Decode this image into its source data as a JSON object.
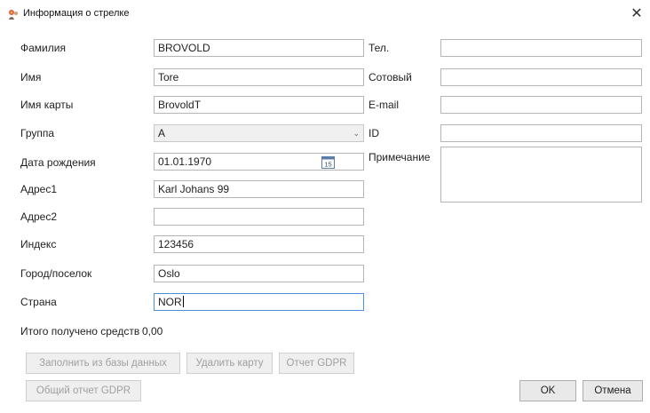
{
  "window": {
    "title": "Информация о стрелке",
    "close_glyph": "✕",
    "icon": "archer-icon"
  },
  "left_fields": [
    {
      "label": "Фамилия",
      "value": "BROVOLD"
    },
    {
      "label": "Имя",
      "value": "Tore"
    },
    {
      "label": "Имя карты",
      "value": "BrovoldT"
    },
    {
      "label": "Группа",
      "value": "A"
    },
    {
      "label": "Дата рождения",
      "value": "01.01.1970"
    },
    {
      "label": "Адрес1",
      "value": "Karl Johans 99"
    },
    {
      "label": "Адрес2",
      "value": ""
    },
    {
      "label": "Индекс",
      "value": "123456"
    },
    {
      "label": "Город/поселок",
      "value": "Oslo"
    },
    {
      "label": "Страна",
      "value": "NOR"
    }
  ],
  "right_fields": [
    {
      "label": "Тел.",
      "value": ""
    },
    {
      "label": "Сотовый",
      "value": ""
    },
    {
      "label": "E-mail",
      "value": ""
    },
    {
      "label": "ID",
      "value": ""
    },
    {
      "label": "Примечание",
      "value": ""
    }
  ],
  "calendar_day": "15",
  "funds": {
    "label": "Итого получено средств",
    "value": "0,00"
  },
  "buttons": {
    "fill_from_db": "Заполнить из базы данных",
    "delete_card": "Удалить карту",
    "gdpr_report": "Отчет GDPR",
    "general_gdpr_report": "Общий отчет GDPR",
    "ok": "OK",
    "cancel": "Отмена"
  }
}
